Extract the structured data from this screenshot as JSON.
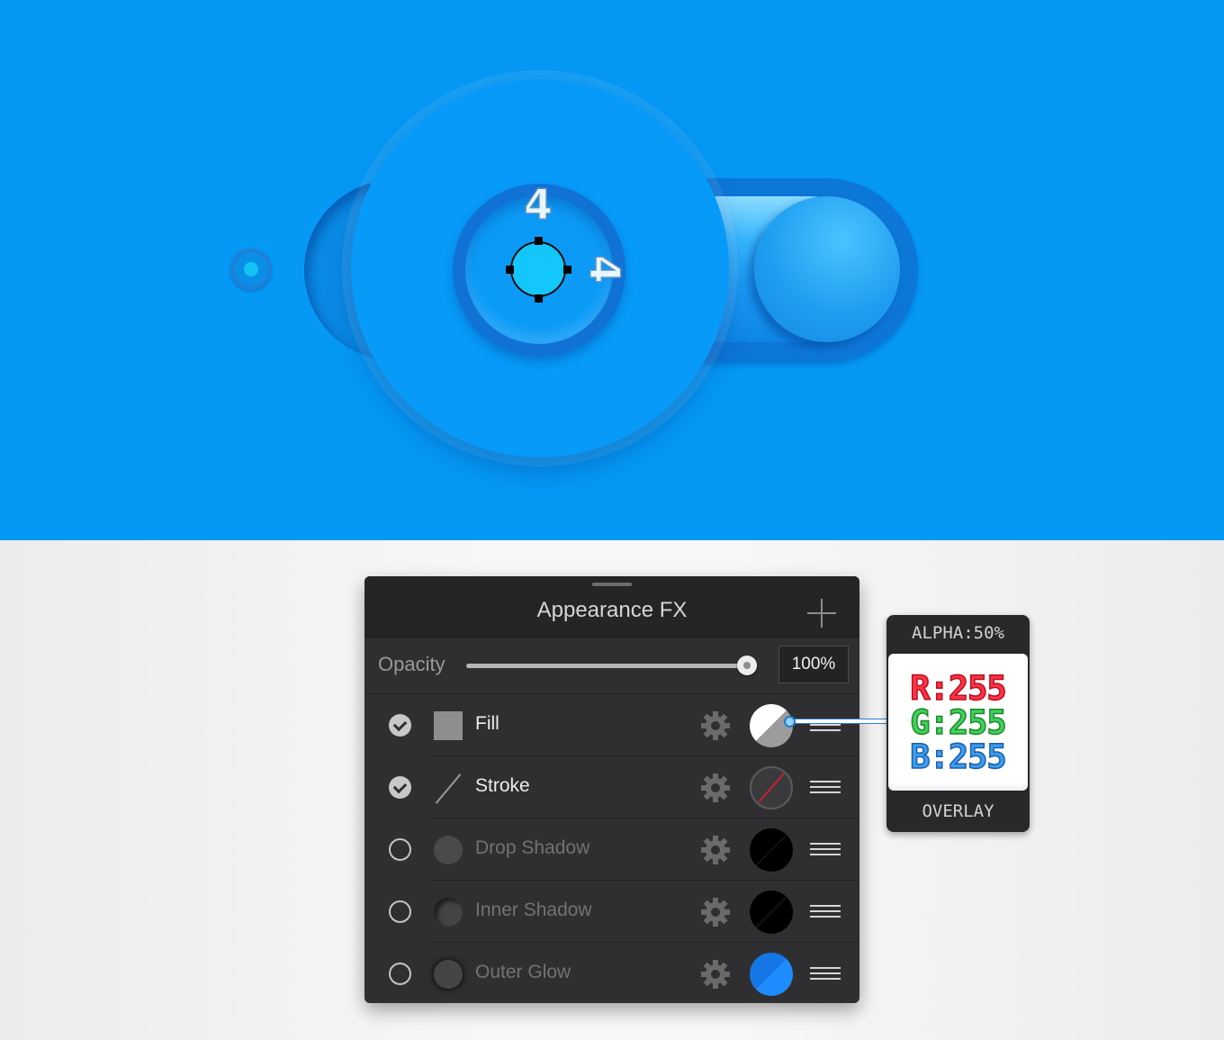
{
  "canvas": {
    "width_dimension_label": "4",
    "height_dimension_label": "4",
    "background_color": "#0599f5"
  },
  "panel": {
    "title": "Appearance FX",
    "add_icon": "plus-icon",
    "opacity": {
      "label": "Opacity",
      "value": "100%",
      "level": 1.0
    },
    "effects": [
      {
        "label": "Fill",
        "enabled": true,
        "icon": "fill-swatch-icon",
        "swatch": "white-gray-split"
      },
      {
        "label": "Stroke",
        "enabled": true,
        "icon": "stroke-line-icon",
        "swatch": "none-red-slash"
      },
      {
        "label": "Drop Shadow",
        "enabled": false,
        "icon": "drop-shadow-icon",
        "swatch": "black"
      },
      {
        "label": "Inner Shadow",
        "enabled": false,
        "icon": "inner-shadow-icon",
        "swatch": "black"
      },
      {
        "label": "Outer Glow",
        "enabled": false,
        "icon": "outer-glow-icon",
        "swatch": "blue"
      }
    ]
  },
  "overlay_tooltip": {
    "alpha": "ALPHA:50%",
    "r": "R:255",
    "g": "G:255",
    "b": "B:255",
    "mode": "OVERLAY"
  }
}
